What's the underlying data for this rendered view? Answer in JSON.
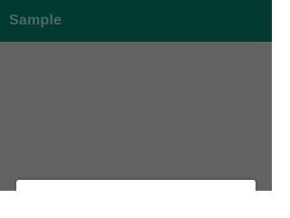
{
  "app": {
    "title": "Sample"
  },
  "colors": {
    "appbar": "#003a31",
    "scrim_background": "#636363",
    "sheet": "#ffffff"
  }
}
